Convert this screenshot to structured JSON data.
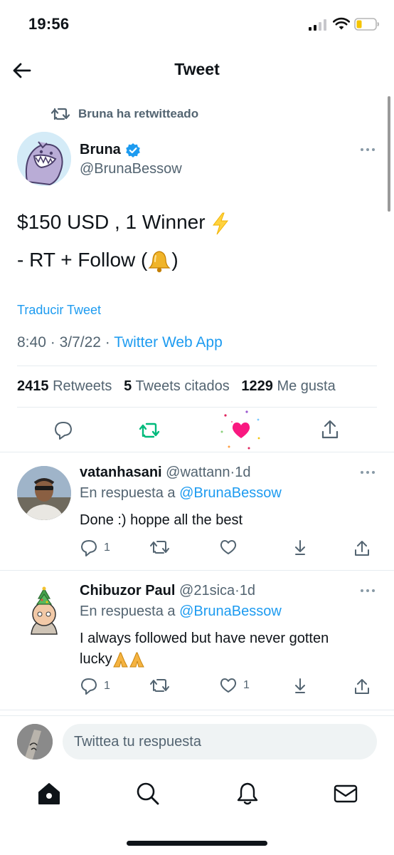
{
  "status": {
    "time": "19:56"
  },
  "nav": {
    "title": "Tweet"
  },
  "retweet_context": {
    "label": "Bruna ha retwitteado"
  },
  "tweet": {
    "author_name": "Bruna",
    "author_handle": "@BrunaBessow",
    "line1": "$150 USD , 1 Winner",
    "line2_pre": "- RT + Follow (",
    "line2_post": ")",
    "translate": "Traducir Tweet",
    "time": "8:40",
    "date": "3/7/22",
    "source": "Twitter Web App",
    "sep": "·",
    "stats": {
      "retweets_count": "2415",
      "retweets_label": "Retweets",
      "quotes_count": "5",
      "quotes_label": "Tweets citados",
      "likes_count": "1229",
      "likes_label": "Me gusta"
    }
  },
  "replies": [
    {
      "name": "vatanhasani",
      "handle": "@wattann",
      "age": "1d",
      "reply_prefix": "En respuesta a",
      "reply_to": "@BrunaBessow",
      "text": "Done :) hoppe all the best",
      "reply_count": "1",
      "retweet_count": "",
      "like_count": ""
    },
    {
      "name": "Chibuzor Paul",
      "handle": "@21sica",
      "age": "1d",
      "reply_prefix": "En respuesta a",
      "reply_to": "@BrunaBessow",
      "text": "I always followed but have never gotten lucky",
      "reply_count": "1",
      "retweet_count": "",
      "like_count": "1"
    }
  ],
  "compose": {
    "placeholder": "Twittea tu respuesta"
  },
  "colors": {
    "accent": "#1d9bf0",
    "retweet_green": "#00ba7c",
    "like_pink": "#f91880",
    "muted": "#536471"
  },
  "icons": [
    "back-arrow-icon",
    "retweet-icon",
    "verified-icon",
    "more-icon",
    "reply-icon",
    "like-icon",
    "share-icon",
    "home-icon",
    "search-icon",
    "notifications-icon",
    "messages-icon"
  ]
}
